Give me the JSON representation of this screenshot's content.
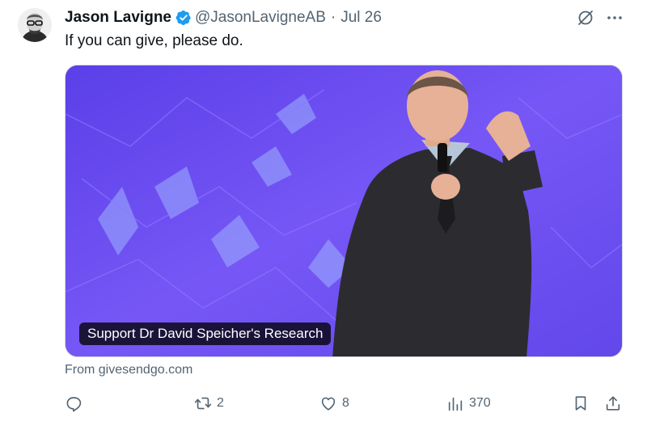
{
  "author": {
    "name": "Jason Lavigne",
    "handle": "@JasonLavigneAB",
    "separator": "·",
    "date": "Jul 26",
    "verified_color": "#1d9bf0"
  },
  "tweet": {
    "text": "If you can give, please do."
  },
  "media": {
    "caption": "Support Dr David Speicher's Research",
    "source": "From givesendgo.com"
  },
  "actions": {
    "reply_count": "",
    "retweet_count": "2",
    "like_count": "8",
    "view_count": "370"
  },
  "icons": {
    "header": [
      "grok-icon",
      "more-icon"
    ],
    "actions": [
      "reply-icon",
      "retweet-icon",
      "like-icon",
      "views-icon",
      "bookmark-icon",
      "share-icon"
    ]
  },
  "colors": {
    "text": "#0f1419",
    "secondary": "#536471",
    "verified": "#1d9bf0",
    "media_background": "#6a4ef0"
  }
}
